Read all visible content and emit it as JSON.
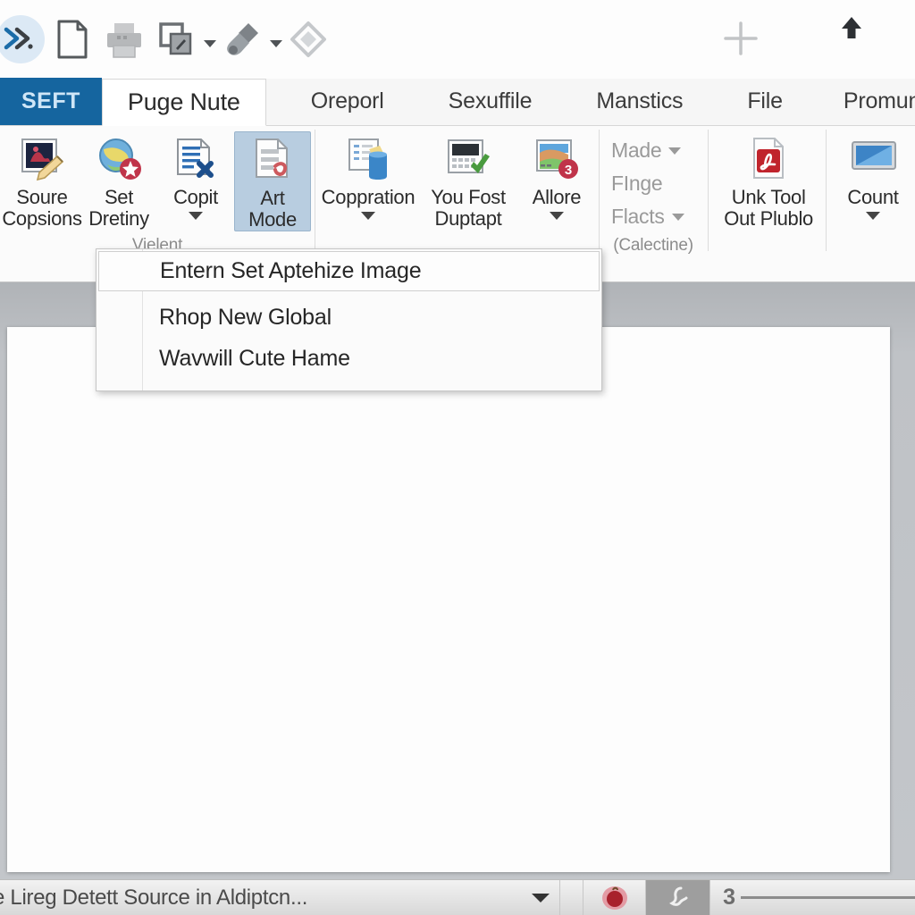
{
  "window": {
    "app_kind": "ribbon-office-application"
  },
  "quick_access_toolbar": {
    "items": [
      {
        "name": "app-logo-icon",
        "icon": "chevrons-right-icon",
        "label": ""
      },
      {
        "name": "new-document-icon",
        "icon": "document-icon",
        "label": ""
      },
      {
        "name": "print-icon",
        "icon": "printer-icon",
        "label": ""
      },
      {
        "name": "copy-edit-icon",
        "icon": "copy-edit-icon",
        "label": "",
        "has_caret": true
      },
      {
        "name": "format-painter-icon",
        "icon": "paintbrush-icon",
        "label": "",
        "has_caret": true
      },
      {
        "name": "tag-icon",
        "icon": "tag-outline-icon",
        "label": ""
      }
    ],
    "add_icon": "plus-icon",
    "collapse_icon": "arrow-up-icon"
  },
  "tabs": {
    "file_tab": "SEFT",
    "items": [
      {
        "label": "Puge Nute",
        "active": true
      },
      {
        "label": "Oreporl",
        "active": false
      },
      {
        "label": "Sexuffile",
        "active": false
      },
      {
        "label": "Manstics",
        "active": false
      },
      {
        "label": "File",
        "active": false
      },
      {
        "label": "Promunt",
        "active": false
      }
    ]
  },
  "ribbon": {
    "groups": [
      {
        "label": "Vielent",
        "buttons": [
          {
            "label_line1": "Soure",
            "label_line2": "Copsions",
            "icon": "image-edit-icon",
            "caret": false,
            "selected": false
          },
          {
            "label_line1": "Set",
            "label_line2": "Dretiny",
            "icon": "globe-star-icon",
            "caret": false,
            "selected": false
          },
          {
            "label_line1": "Copit",
            "label_line2": "",
            "icon": "page-x-icon",
            "caret": true,
            "selected": false
          },
          {
            "label_line1": "Art",
            "label_line2": "Mode",
            "icon": "page-edit-icon",
            "caret": false,
            "selected": true
          }
        ]
      },
      {
        "label": "",
        "buttons": [
          {
            "label_line1": "Coppration",
            "label_line2": "",
            "icon": "chart-bucket-icon",
            "caret": true,
            "selected": false
          },
          {
            "label_line1": "You Fost",
            "label_line2": "Duptapt",
            "icon": "screen-check-icon",
            "caret": false,
            "selected": false
          },
          {
            "label_line1": "Allore",
            "label_line2": "",
            "icon": "palette-badge-icon",
            "caret": true,
            "selected": false
          }
        ]
      },
      {
        "label": "(Calectine)",
        "small_items": [
          {
            "label": "Made",
            "caret": true
          },
          {
            "label": "FInge",
            "caret": false
          },
          {
            "label": "Flacts",
            "caret": true
          }
        ]
      },
      {
        "label": "",
        "buttons": [
          {
            "label_line1": "Unk Tool",
            "label_line2": "Out Plublo",
            "icon": "pdf-icon",
            "caret": false,
            "selected": false
          }
        ]
      },
      {
        "label": "",
        "buttons": [
          {
            "label_line1": "Count",
            "label_line2": "",
            "icon": "monitor-icon",
            "caret": true,
            "selected": false
          }
        ]
      }
    ]
  },
  "dropdown_menu": {
    "items": [
      {
        "label": "Entern Set Aptehize Image",
        "highlighted": true
      },
      {
        "label": "Rhop New Global",
        "highlighted": false
      },
      {
        "label": "Wavwill Cute Hame",
        "highlighted": false
      }
    ]
  },
  "status_bar": {
    "text": "e Lireg Detett Source in Aldiptcn...",
    "caret_icon": "chevron-down-icon",
    "buttons": [
      {
        "name": "red-badge-icon",
        "icon": "red-circle-icon",
        "active": false
      },
      {
        "name": "edit-mode-icon",
        "icon": "cursor-icon",
        "active": true
      }
    ],
    "zoom_level": "3"
  },
  "colors": {
    "file_tab_blue": "#15659f",
    "selected_button": "#b8cde0",
    "ribbon_bg": "#fbfbfb",
    "workspace_gray": "#bfc2c6",
    "page_white": "#fdfdfd"
  }
}
